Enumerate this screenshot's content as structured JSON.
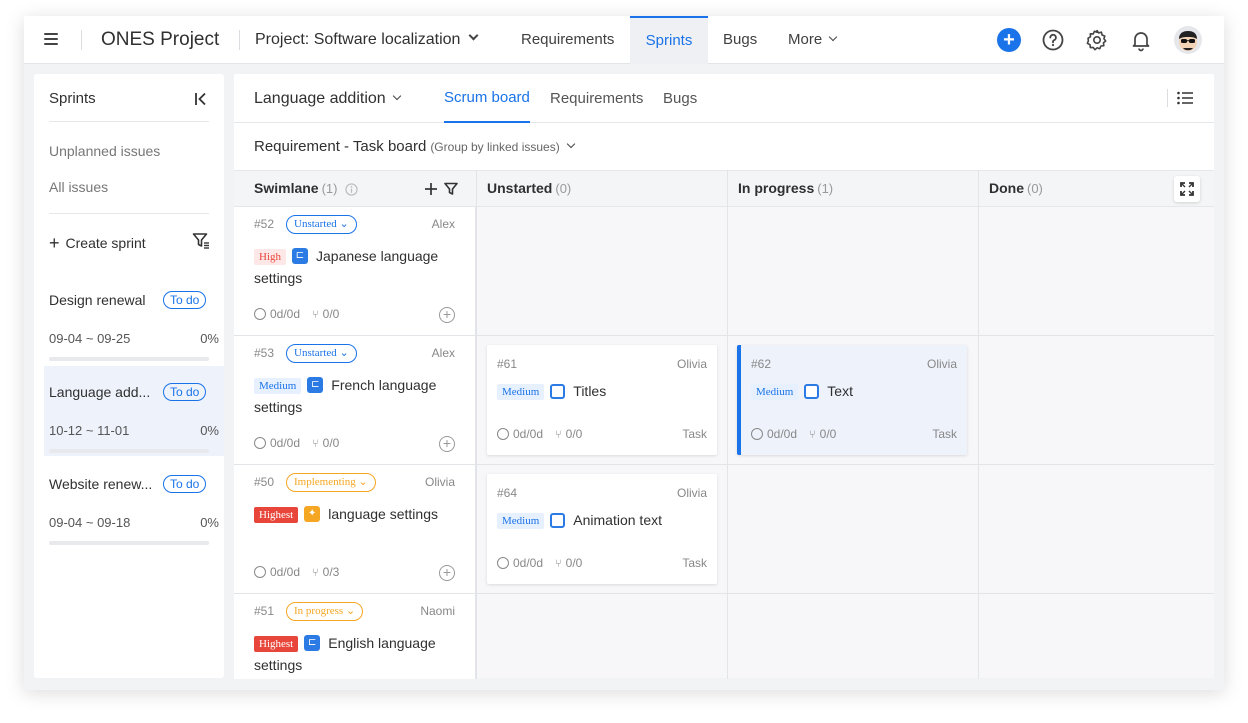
{
  "app": {
    "title": "ONES Project"
  },
  "project": {
    "label": "Project: Software localization"
  },
  "nav": {
    "tabs": [
      "Requirements",
      "Sprints",
      "Bugs",
      "More"
    ],
    "active": "Sprints"
  },
  "sidebar": {
    "title": "Sprints",
    "links": [
      "Unplanned issues",
      "All issues"
    ],
    "create_label": "Create sprint",
    "sprints": [
      {
        "name": "Design renewal",
        "status": "To do",
        "dates": "09-04 ~ 09-25",
        "progress": "0%"
      },
      {
        "name": "Language add...",
        "status": "To do",
        "dates": "10-12 ~ 11-01",
        "progress": "0%"
      },
      {
        "name": "Website renew...",
        "status": "To do",
        "dates": "09-04 ~ 09-18",
        "progress": "0%"
      }
    ]
  },
  "main": {
    "sprint_label": "Language addition",
    "tabs": [
      "Scrum board",
      "Requirements",
      "Bugs"
    ],
    "board_title": "Requirement - Task board",
    "board_group": "(Group by linked issues)",
    "columns": [
      {
        "name": "Swimlane",
        "count": "(1)"
      },
      {
        "name": "Unstarted",
        "count": "(0)"
      },
      {
        "name": "In progress",
        "count": "(1)"
      },
      {
        "name": "Done",
        "count": "(0)"
      }
    ]
  },
  "swimlanes": [
    {
      "id": "#52",
      "status": "Unstarted",
      "assignee": "Alex",
      "priority": "High",
      "title": "Japanese language settings",
      "time": "0d/0d",
      "subtasks": "0/0"
    },
    {
      "id": "#53",
      "status": "Unstarted",
      "assignee": "Alex",
      "priority": "Medium",
      "title": "French language settings",
      "time": "0d/0d",
      "subtasks": "0/0"
    },
    {
      "id": "#50",
      "status": "Implementing",
      "assignee": "Olivia",
      "priority": "Highest",
      "title": "language settings",
      "time": "0d/0d",
      "subtasks": "0/3"
    },
    {
      "id": "#51",
      "status": "In progress",
      "assignee": "Naomi",
      "priority": "Highest",
      "title": "English language settings",
      "time": "",
      "subtasks": ""
    }
  ],
  "cards": [
    {
      "id": "#61",
      "assignee": "Olivia",
      "priority": "Medium",
      "title": "Titles",
      "time": "0d/0d",
      "subtasks": "0/0",
      "type": "Task"
    },
    {
      "id": "#62",
      "assignee": "Olivia",
      "priority": "Medium",
      "title": "Text",
      "time": "0d/0d",
      "subtasks": "0/0",
      "type": "Task"
    },
    {
      "id": "#64",
      "assignee": "Olivia",
      "priority": "Medium",
      "title": "Animation text",
      "time": "0d/0d",
      "subtasks": "0/0",
      "type": "Task"
    }
  ],
  "colors": {
    "accent": "#1a73e8",
    "status_blue": "#1a73e8",
    "status_orange": "#f5a623",
    "priority_red": "#e8463a"
  },
  "icons": [
    "menu-icon",
    "chevron-down-icon",
    "plus-icon",
    "help-icon",
    "gear-icon",
    "bell-icon",
    "collapse-icon",
    "filter-icon",
    "list-icon",
    "info-icon",
    "expand-icon",
    "clock-icon",
    "subtask-icon",
    "add-circle-icon"
  ]
}
